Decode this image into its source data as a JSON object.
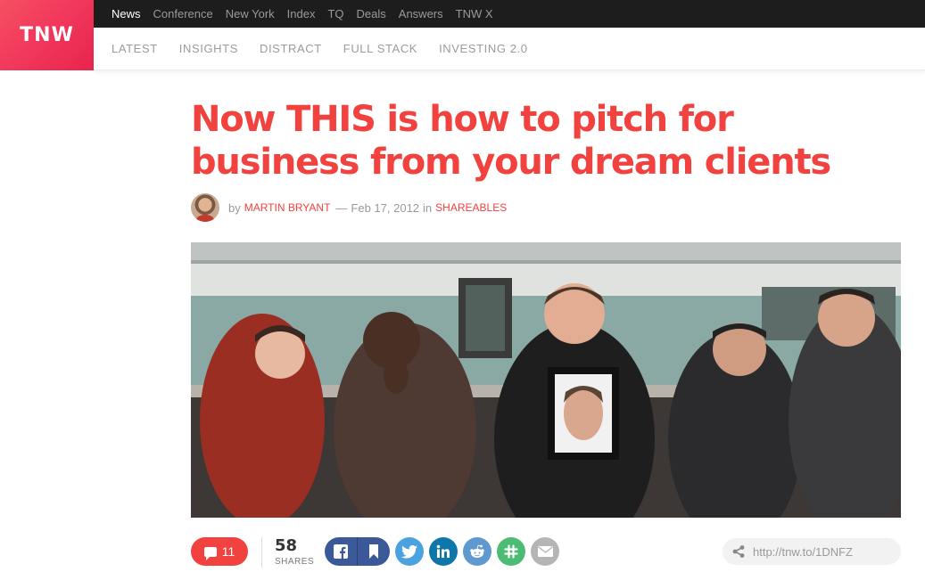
{
  "logo": {
    "text": "TNW"
  },
  "topbar": {
    "items": [
      {
        "label": "News",
        "active": true
      },
      {
        "label": "Conference"
      },
      {
        "label": "New York"
      },
      {
        "label": "Index"
      },
      {
        "label": "TQ"
      },
      {
        "label": "Deals"
      },
      {
        "label": "Answers"
      },
      {
        "label": "TNW X"
      }
    ]
  },
  "subnav": {
    "items": [
      "LATEST",
      "INSIGHTS",
      "DISTRACT",
      "FULL STACK",
      "INVESTING 2.0"
    ]
  },
  "article": {
    "title": "Now THIS is how to pitch for business from your dream clients",
    "by": "by",
    "author": "MARTIN BRYANT",
    "separator": "—",
    "date": "Feb 17, 2012",
    "in": "in",
    "category": "SHAREABLES"
  },
  "share": {
    "comments": "11",
    "shares_count": "58",
    "shares_label": "SHARES",
    "short_url": "http://tnw.to/1DNFZ"
  },
  "colors": {
    "accent": "#f2423f",
    "facebook": "#3b5998",
    "twitter": "#4aa3df",
    "linkedin": "#0e76a8",
    "reddit": "#5f99cf",
    "slack": "#4cbb73",
    "mail": "#b5b5b5"
  },
  "icons": [
    "facebook-icon",
    "bookmark-icon",
    "twitter-icon",
    "linkedin-icon",
    "reddit-icon",
    "slack-icon",
    "mail-icon",
    "link-icon",
    "comment-icon"
  ]
}
